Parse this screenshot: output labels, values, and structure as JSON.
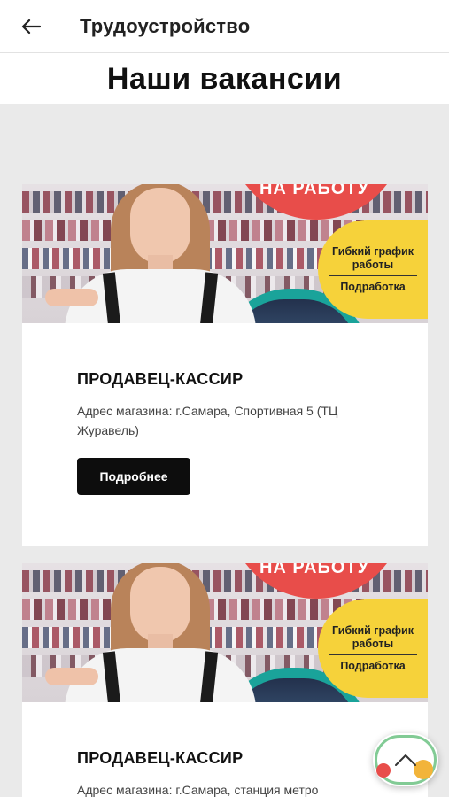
{
  "header": {
    "title": "Трудоустройство",
    "back_icon": "arrow-left-icon"
  },
  "page": {
    "title": "Наши вакансии"
  },
  "vacancies": [
    {
      "banner": {
        "red_text": "НА РАБОТУ",
        "yellow_line1": "Гибкий график работы",
        "yellow_line2": "Подработка"
      },
      "title": "ПРОДАВЕЦ-КАССИР",
      "address": "Адрес магазина: г.Самара, Спортивная 5 (ТЦ Журавель)",
      "button": "Подробнее"
    },
    {
      "banner": {
        "red_text": "НА РАБОТУ",
        "yellow_line1": "Гибкий график работы",
        "yellow_line2": "Подработка"
      },
      "title": "ПРОДАВЕЦ-КАССИР",
      "address": "Адрес магазина: г.Самара, станция метро"
    }
  ],
  "scroll_top": {
    "icon": "chevron-up-icon"
  },
  "colors": {
    "banner_red": "#e84d4a",
    "banner_yellow": "#f6d23a",
    "button_bg": "#0d0d0d",
    "page_bg": "#eaeaea"
  }
}
